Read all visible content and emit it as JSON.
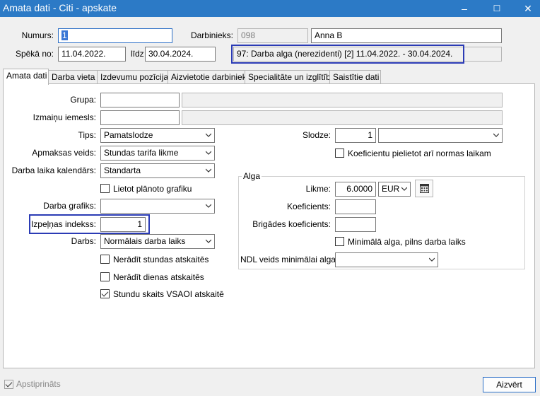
{
  "window": {
    "title": "Amata dati - Citi - apskate",
    "minimize": "–",
    "maximize": "☐",
    "close": "✕"
  },
  "header": {
    "numurs_label": "Numurs:",
    "numurs_value": "1",
    "darbinieks_label": "Darbinieks:",
    "darbinieks_code": "098",
    "darbinieks_name": "Anna B",
    "speka_no_label": "Spēkā no:",
    "speka_no_value": "11.04.2022.",
    "lidz_label": "līdz",
    "lidz_value": "30.04.2024.",
    "summary": "97: Darba alga (nerezidenti) [2] 11.04.2022. - 30.04.2024."
  },
  "tabs": [
    {
      "label": "Amata dati"
    },
    {
      "label": "Darba vieta"
    },
    {
      "label": "Izdevumu pozīcijas"
    },
    {
      "label": "Aizvietotie darbinieki"
    },
    {
      "label": "Specialitāte un izglītība"
    },
    {
      "label": "Saistītie dati"
    }
  ],
  "form": {
    "grupa_label": "Grupa:",
    "izmainu_label": "Izmaiņu iemesls:",
    "tips_label": "Tips:",
    "tips_value": "Pamatslodze",
    "apmaksas_label": "Apmaksas veids:",
    "apmaksas_value": "Stundas tarifa likme",
    "kalendars_label": "Darba laika kalendārs:",
    "kalendars_value": "Standarta",
    "lietot_grafiku_label": "Lietot plānoto grafiku",
    "darba_grafiks_label": "Darba grafiks:",
    "izpelnas_label": "Izpeļņas indekss:",
    "izpelnas_value": "1",
    "darbs_label": "Darbs:",
    "darbs_value": "Normālais darba laiks",
    "nerad_stundas_label": "Nerādīt stundas atskaitēs",
    "nerad_dienas_label": "Nerādīt dienas atskaitēs",
    "stundu_vsaoi_label": "Stundu skaits VSAOI atskaitē",
    "slodze_label": "Slodze:",
    "slodze_value": "1",
    "koef_normas_label": "Koeficientu pielietot arī normas laikam"
  },
  "alga": {
    "title": "Alga",
    "likme_label": "Likme:",
    "likme_value": "6.0000",
    "currency": "EUR",
    "koeficients_label": "Koeficients:",
    "brigades_label": "Brigādes koeficients:",
    "minimala_label": "Minimālā alga, pilns darba laiks",
    "ndl_label": "NDL veids minimālai algai:"
  },
  "footer": {
    "apstiprinats_label": "Apstiprināts",
    "aizvert_label": "Aizvērt"
  },
  "icons": [
    "calendar-icon",
    "chevron-down-icon",
    "checkbox"
  ]
}
